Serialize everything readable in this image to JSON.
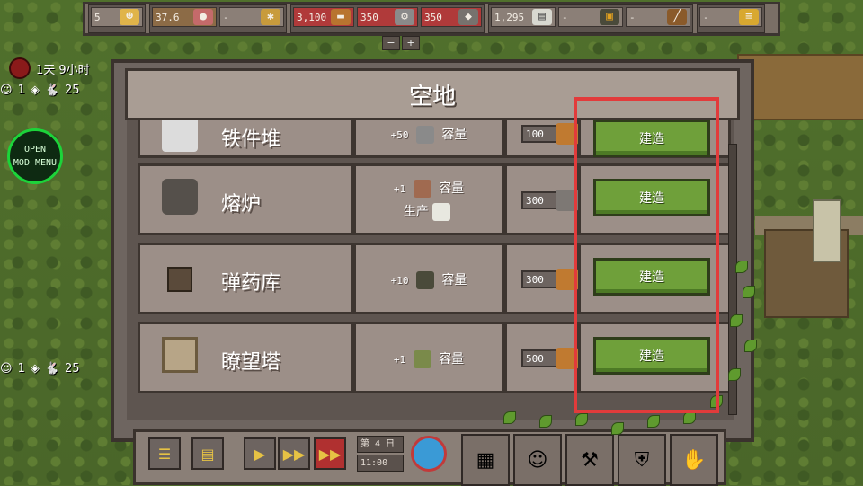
{
  "colors": {
    "accent_green": "#6fa03a",
    "highlight_red": "#e23b3b",
    "panel": "#9c8f88"
  },
  "topbar": {
    "resources": [
      {
        "value": "5",
        "icon": "settler-icon",
        "style": "grey"
      },
      {
        "value": "37.6",
        "icon": "meat-icon",
        "style": "brown"
      },
      {
        "value": "-",
        "icon": "wheat-icon",
        "style": "grey"
      },
      {
        "value": "3,100",
        "icon": "wood-icon",
        "style": "red"
      },
      {
        "value": "350",
        "icon": "iron-parts-icon",
        "style": "red"
      },
      {
        "value": "350",
        "icon": "stone-icon",
        "style": "red"
      },
      {
        "value": "1,295",
        "icon": "paper-icon",
        "style": "grey"
      },
      {
        "value": "-",
        "icon": "ammo-icon",
        "style": "grey"
      },
      {
        "value": "-",
        "icon": "weapon-icon",
        "style": "grey"
      },
      {
        "value": "-",
        "icon": "gold-icon",
        "style": "grey"
      }
    ],
    "zoom_out": "−",
    "zoom_in": "+"
  },
  "hud": {
    "day_time": "1天 9小时",
    "pop_a": {
      "settlers": "1",
      "animals": "25"
    },
    "pop_b": {
      "settlers": "1",
      "animals": "25"
    },
    "mod_menu": "OPEN\nMOD MENU"
  },
  "modal": {
    "title": "空地",
    "rows": [
      {
        "name": "铁件堆",
        "icon": "iron-pile-icon",
        "effects": [
          {
            "num": "+50",
            "icon": "gear-icon",
            "label": "容量"
          }
        ],
        "cost": {
          "value": "100",
          "icon": "wood-icon"
        },
        "button": "建造"
      },
      {
        "name": "熔炉",
        "icon": "furnace-icon",
        "effects": [
          {
            "num": "+1",
            "icon": "worker-icon",
            "label": "容量"
          },
          {
            "num": "",
            "icon": "paper-icon",
            "label": "生产"
          }
        ],
        "cost": {
          "value": "300",
          "icon": "stone-icon"
        },
        "button": "建造"
      },
      {
        "name": "弹药库",
        "icon": "ammo-depot-icon",
        "effects": [
          {
            "num": "+10",
            "icon": "ammo-icon",
            "label": "容量"
          }
        ],
        "cost": {
          "value": "300",
          "icon": "wood-icon"
        },
        "button": "建造"
      },
      {
        "name": "瞭望塔",
        "icon": "watchtower-icon",
        "effects": [
          {
            "num": "+1",
            "icon": "soldier-icon",
            "label": "容量"
          }
        ],
        "cost": {
          "value": "500",
          "icon": "wood-icon"
        },
        "button": "建造"
      }
    ]
  },
  "bottombar": {
    "day": "第 4 日",
    "time": "11:00"
  }
}
